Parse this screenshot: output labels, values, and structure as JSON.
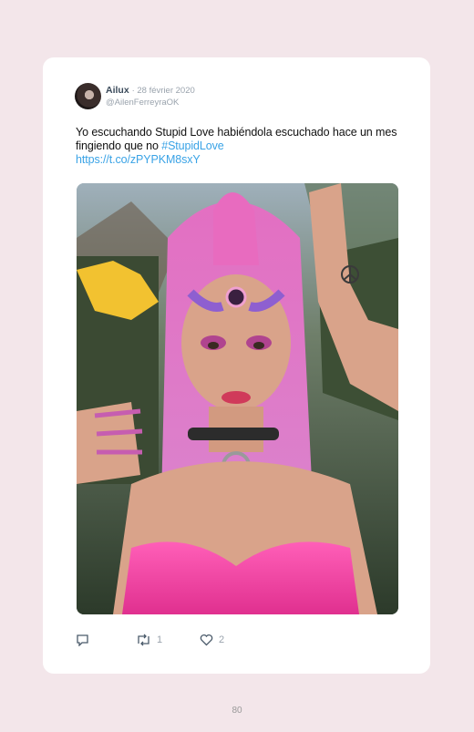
{
  "tweet": {
    "author_name": "Ailux",
    "date": "· 28 février 2020",
    "handle": "@AilenFerreyraOK",
    "text": "Yo escuchando Stupid Love habiéndola escuchado hace un mes fingiendo que no ",
    "hashtag": "#StupidLove",
    "link": "https://t.co/zPYPKM8sxY",
    "reply_count": "",
    "retweet_count": "1",
    "like_count": "2"
  },
  "icons": {
    "reply": "reply-icon",
    "retweet": "retweet-icon",
    "like": "heart-icon"
  },
  "colors": {
    "background": "#f3e6ea",
    "card": "#ffffff",
    "link": "#3aa3e6",
    "muted": "#9aa3ad",
    "pink_accent": "#e24fa6"
  },
  "page": {
    "number": "80"
  }
}
